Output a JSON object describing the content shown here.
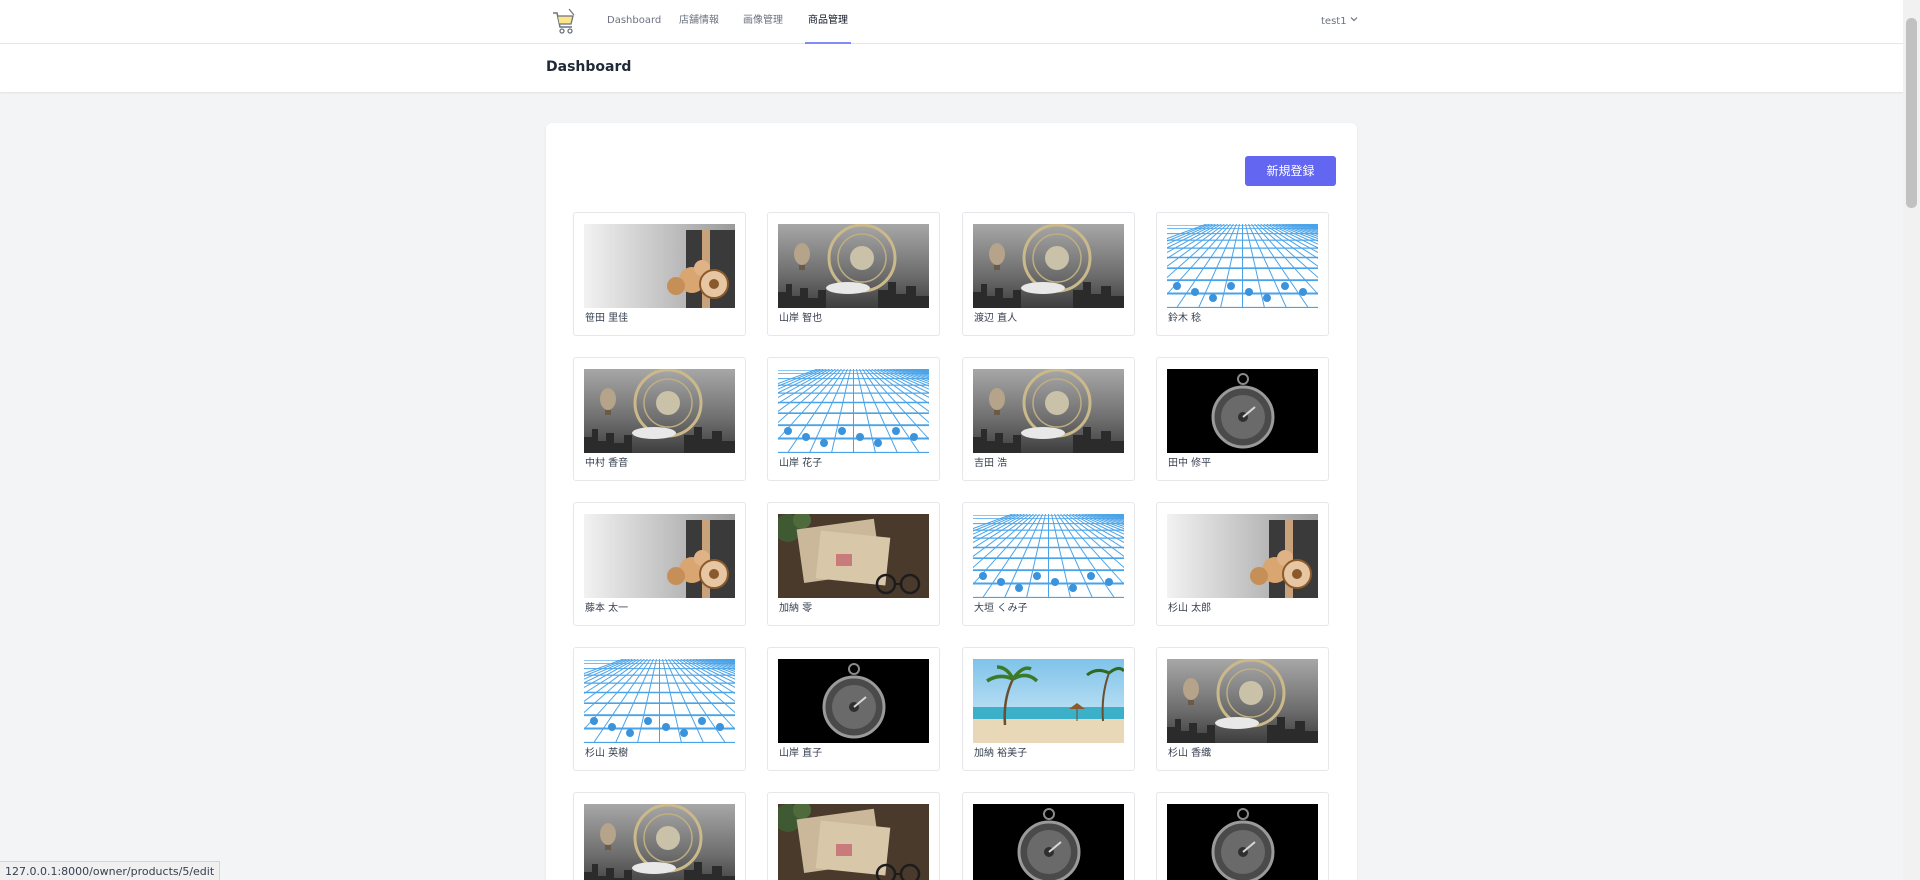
{
  "nav": {
    "logo": "cart-logo",
    "links": [
      "Dashboard",
      "店舗情報",
      "画像管理",
      "商品管理"
    ],
    "active": "商品管理",
    "user": "test1"
  },
  "header": {
    "title": "Dashboard"
  },
  "main": {
    "new_button": "新規登録"
  },
  "products": [
    {
      "name": "笹田 里佳",
      "image": "gift"
    },
    {
      "name": "山岸 智也",
      "image": "balloon"
    },
    {
      "name": "渡辺 直人",
      "image": "balloon"
    },
    {
      "name": "鈴木 稔",
      "image": "grid"
    },
    {
      "name": "中村 香音",
      "image": "balloon"
    },
    {
      "name": "山岸 花子",
      "image": "grid"
    },
    {
      "name": "吉田 浩",
      "image": "balloon"
    },
    {
      "name": "田中 修平",
      "image": "watch"
    },
    {
      "name": "藤本 太一",
      "image": "gift"
    },
    {
      "name": "加納 零",
      "image": "letters"
    },
    {
      "name": "大垣 くみ子",
      "image": "grid"
    },
    {
      "name": "杉山 太郎",
      "image": "gift"
    },
    {
      "name": "杉山 英樹",
      "image": "grid"
    },
    {
      "name": "山岸 直子",
      "image": "watch"
    },
    {
      "name": "加納 裕美子",
      "image": "beach"
    },
    {
      "name": "杉山 香織",
      "image": "balloon"
    },
    {
      "name": "",
      "image": "balloon"
    },
    {
      "name": "",
      "image": "letters"
    },
    {
      "name": "",
      "image": "watch"
    },
    {
      "name": "",
      "image": "watch"
    }
  ],
  "status_url": "127.0.0.1:8000/owner/products/5/edit",
  "colors": {
    "accent": "#6366f1",
    "active_underline": "#818cf8",
    "background": "#f3f4f6"
  }
}
